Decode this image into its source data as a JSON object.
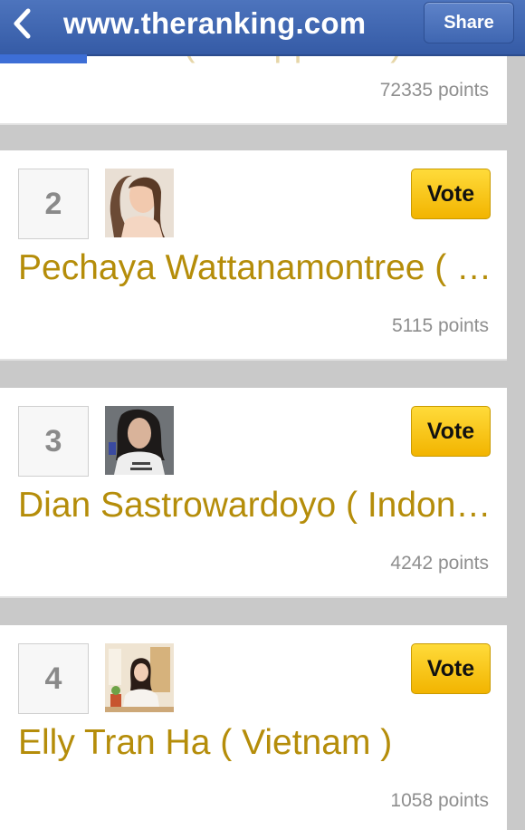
{
  "topbar": {
    "url": "www.theranking.com",
    "share_label": "Share",
    "back_icon": "chevron-left-icon",
    "bg_color": "#3f66b1"
  },
  "entries": [
    {
      "name": "an Rivera ( Philippines )",
      "points": "72335 points"
    },
    {
      "rank": "2",
      "name": "Pechaya Wattanamontree ( …",
      "points": "5115 points",
      "vote_label": "Vote"
    },
    {
      "rank": "3",
      "name": "Dian Sastrowardoyo ( Indon…",
      "points": "4242 points",
      "vote_label": "Vote"
    },
    {
      "rank": "4",
      "name": "Elly Tran Ha ( Vietnam )",
      "points": "1058 points",
      "vote_label": "Vote"
    }
  ],
  "colors": {
    "accent_name": "#b58d0a",
    "vote_button": "#f2b400"
  }
}
